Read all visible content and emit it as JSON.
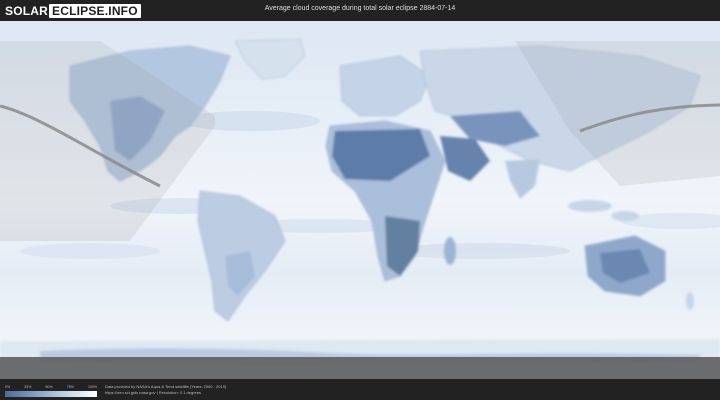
{
  "header": {
    "logo_solar": "SOLAR",
    "logo_eclipse": "ECLIPSE.INFO",
    "title": "Average cloud coverage during total solar eclipse 2884-07-14"
  },
  "map": {
    "projection": "equirectangular",
    "colors": {
      "clear_sky": "#4c6a97",
      "cloudy": "#ffffff",
      "eclipse_path": "#8a8a8a",
      "shadow_overlay": "#d8d8d8"
    }
  },
  "legend": {
    "ticks": [
      "0%",
      "25%",
      "50%",
      "75%",
      "100%"
    ]
  },
  "footer": {
    "credit_line_1": "Data provided by NASA's Aqua & Terra satellite (Years: 2000 - 2019)",
    "credit_line_2": "https://neo.sci.gsfc.nasa.gov | Resolution: 0.1 degrees"
  }
}
